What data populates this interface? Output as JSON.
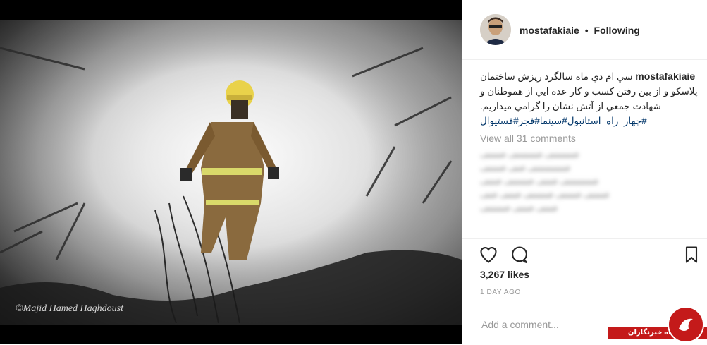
{
  "post": {
    "username": "mostafakiaie",
    "separator": "•",
    "follow_status": "Following",
    "photo_credit": "©Majid Hamed Haghdoust",
    "caption_text": "سي ام دي ماه سالگرد ريزش ساختمان پلاسكو و از بين رفتن كسب و كار عده ايي از هموطنان و شهادت جمعي از آتش نشان را گرامي ميداريم.",
    "hashtags": "#چهار_راه_استانبول#سينما#فجر#فستيوال",
    "view_all_comments": "View all 31 comments",
    "likes": "3,267 likes",
    "time_ago": "1 DAY AGO",
    "comment_placeholder": "Add a comment..."
  },
  "blurred_comments": [
    "ففففففف ففففففف ففففف",
    "ففففففففف ففف ففففف",
    "فففففففف فففف فففففف فففف",
    "ففففف ففففف فففففف فففف ففف",
    "فففف فففف فففففف"
  ],
  "icons": {
    "like": "heart-icon",
    "comment": "speech-bubble-icon",
    "save": "bookmark-icon"
  },
  "watermark_site": "باشگاه خبرنگاران",
  "colors": {
    "hashtag": "#003569",
    "muted": "#999999",
    "text": "#262626",
    "brand_red": "#c41a1a"
  }
}
